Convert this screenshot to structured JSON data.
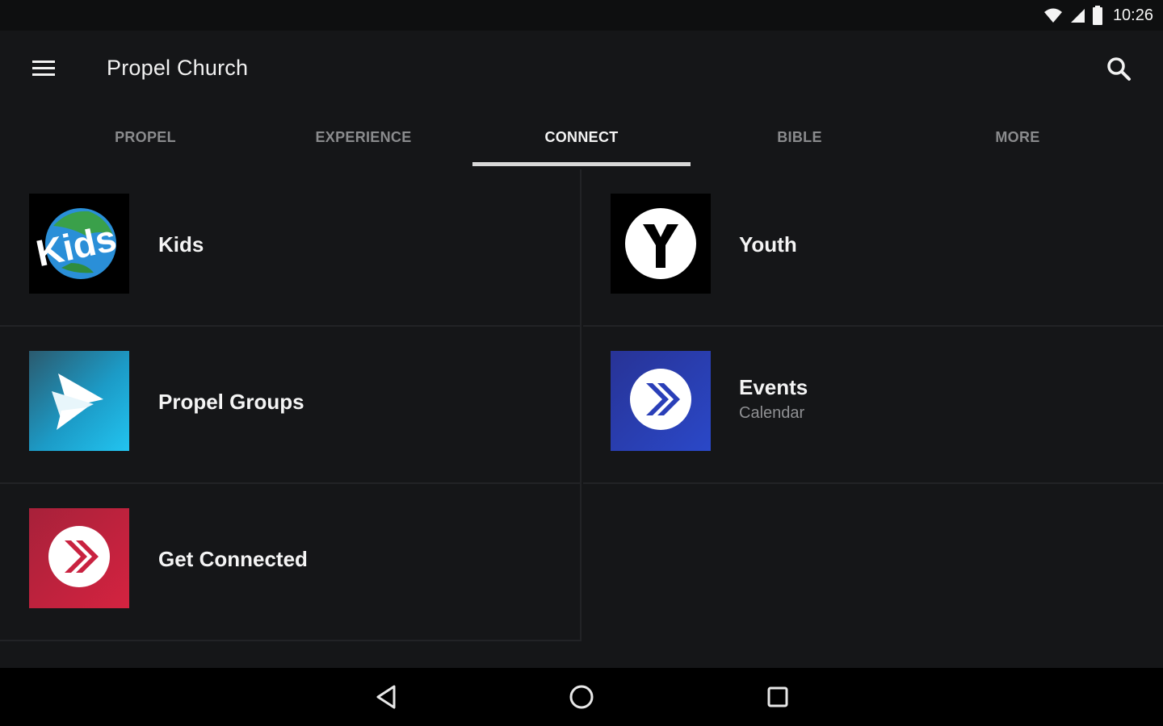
{
  "status_bar": {
    "time": "10:26"
  },
  "app_bar": {
    "title": "Propel Church"
  },
  "tabs": [
    {
      "label": "PROPEL",
      "active": false
    },
    {
      "label": "EXPERIENCE",
      "active": false
    },
    {
      "label": "CONNECT",
      "active": true
    },
    {
      "label": "BIBLE",
      "active": false
    },
    {
      "label": "MORE",
      "active": false
    }
  ],
  "items": {
    "kids": {
      "label": "Kids",
      "icon": "kids-logo-icon",
      "logo_text": "Kids"
    },
    "youth": {
      "label": "Youth",
      "icon": "youth-logo-icon"
    },
    "groups": {
      "label": "Propel Groups",
      "icon": "propel-groups-icon"
    },
    "events": {
      "label": "Events",
      "subtitle": "Calendar",
      "icon": "events-icon"
    },
    "connected": {
      "label": "Get Connected",
      "icon": "get-connected-icon"
    }
  },
  "colors": {
    "background": "#151618",
    "tab_indicator": "#d8d8d8",
    "groups_tile": "#1fb6e0",
    "events_tile": "#2a3fb8",
    "connected_tile": "#d0213f"
  }
}
